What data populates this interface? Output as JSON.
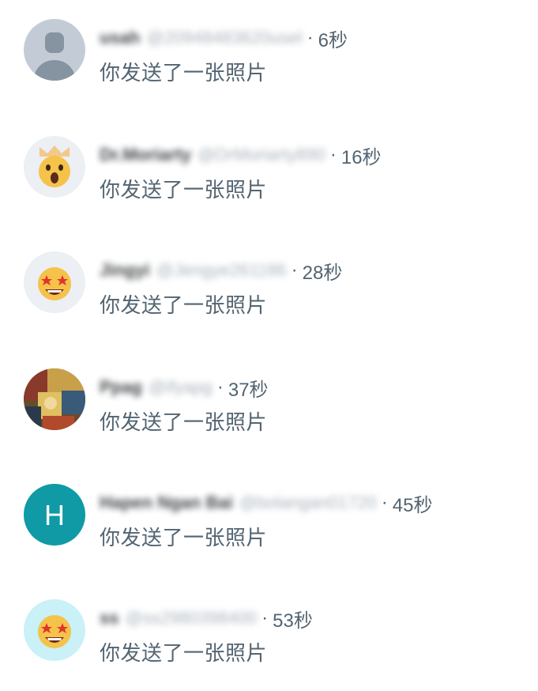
{
  "notifications": [
    {
      "name": "usah",
      "handle": "@20948483620usel",
      "separator": "·",
      "time": "6秒",
      "message": "你发送了一张照片",
      "avatar_icon": "default-user-icon",
      "avatar_color": "#c3ccd6"
    },
    {
      "name": "Dr.Moriarty",
      "handle": "@DrMoriarty890",
      "separator": "·",
      "time": "16秒",
      "message": "你发送了一张照片",
      "avatar_icon": "shocked-emoji-icon",
      "avatar_color": "#eceff3"
    },
    {
      "name": "Jingyi",
      "handle": "@Jengye261186",
      "separator": "·",
      "time": "28秒",
      "message": "你发送了一张照片",
      "avatar_icon": "star-eyes-emoji-icon",
      "avatar_color": "#eceff3"
    },
    {
      "name": "Ppag",
      "handle": "@ifyapg",
      "separator": "·",
      "time": "37秒",
      "message": "你发送了一张照片",
      "avatar_icon": "photo-avatar-icon",
      "avatar_color": "#6b4a2a"
    },
    {
      "name": "Hapen Ngan Bai",
      "handle": "@bolangan01720",
      "separator": "·",
      "time": "45秒",
      "message": "你发送了一张照片",
      "avatar_icon": "letter-h-avatar-icon",
      "avatar_letter": "H",
      "avatar_color": "#0f9aa5"
    },
    {
      "name": "ss",
      "handle": "@ss2980398400",
      "separator": "·",
      "time": "53秒",
      "message": "你发送了一张照片",
      "avatar_icon": "star-eyes-emoji-icon",
      "avatar_color": "#c9f1f7"
    }
  ]
}
